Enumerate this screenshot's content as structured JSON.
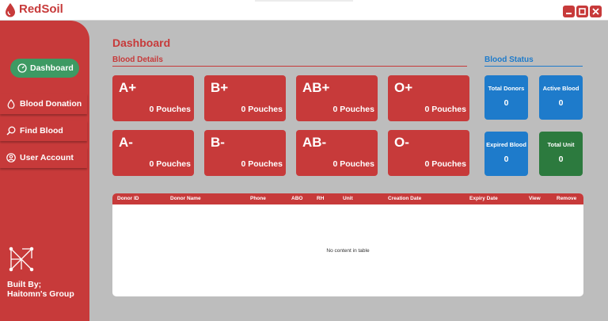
{
  "app": {
    "title": "RedSoil"
  },
  "sidebar": {
    "items": [
      {
        "label": "Dashboard"
      },
      {
        "label": "Blood Donation"
      },
      {
        "label": "Find Blood"
      },
      {
        "label": "User Account"
      }
    ],
    "credit_line1": "Built By;",
    "credit_line2": "Haitomn's Group"
  },
  "dashboard": {
    "title": "Dashboard",
    "blood_details_title": "Blood Details",
    "blood_status_title": "Blood Status",
    "blood_groups": [
      {
        "type": "A+",
        "amount": "0 Pouches"
      },
      {
        "type": "B+",
        "amount": "0 Pouches"
      },
      {
        "type": "AB+",
        "amount": "0 Pouches"
      },
      {
        "type": "O+",
        "amount": "0 Pouches"
      },
      {
        "type": "A-",
        "amount": "0 Pouches"
      },
      {
        "type": "B-",
        "amount": "0 Pouches"
      },
      {
        "type": "AB-",
        "amount": "0 Pouches"
      },
      {
        "type": "O-",
        "amount": "0 Pouches"
      }
    ],
    "status": [
      {
        "label": "Total Donors",
        "value": "0"
      },
      {
        "label": "Active Blood",
        "value": "0"
      },
      {
        "label": "Expired Blood",
        "value": "0"
      },
      {
        "label": "Total Unit",
        "value": "0"
      }
    ]
  },
  "table": {
    "columns": [
      "Donor ID",
      "Donor Name",
      "Phone",
      "ABO",
      "RH",
      "Unit",
      "Creation Date",
      "Expiry Date",
      "View",
      "Remove"
    ],
    "empty_message": "No content in table"
  },
  "colors": {
    "brand_red": "#c73a3a",
    "active_green": "#3d9a63",
    "status_blue": "#1e7bcb",
    "status_green": "#2c7a3e",
    "background_gray": "#bdbdbd"
  }
}
